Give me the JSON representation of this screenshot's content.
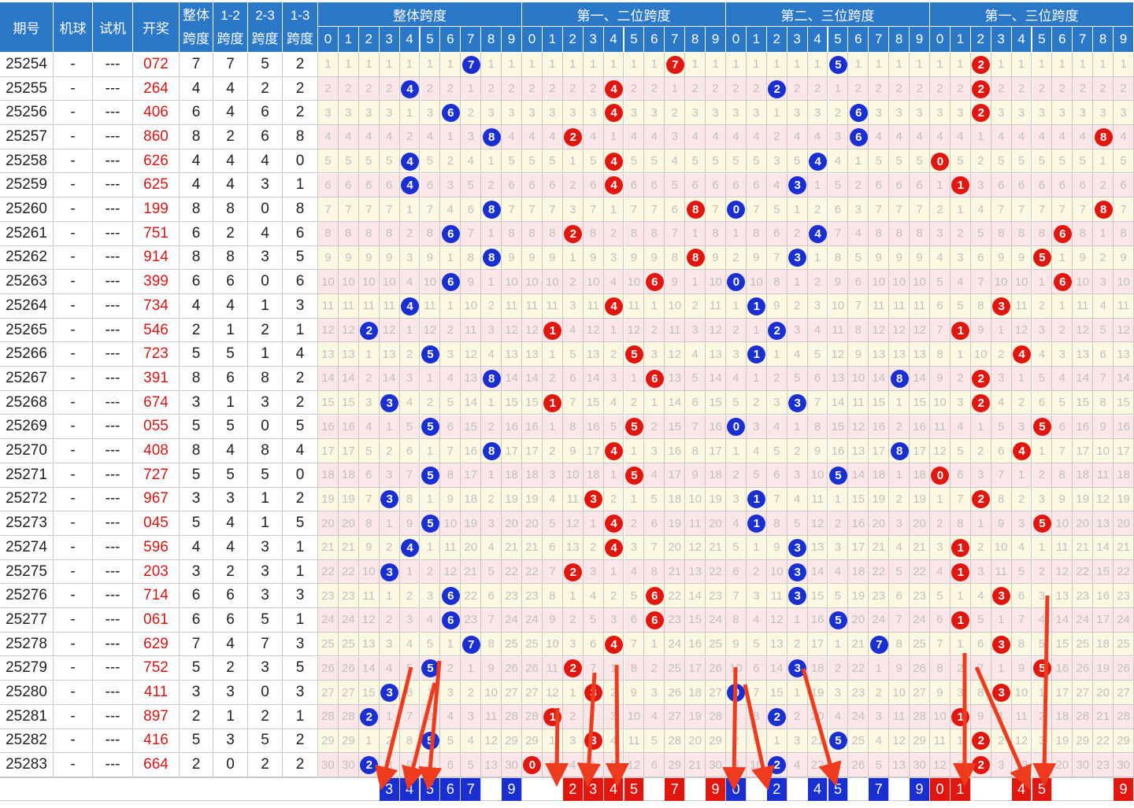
{
  "headers": {
    "issue": "期号",
    "machine": "机球",
    "trial": "试机",
    "open": "开奖",
    "span_total": "整体跨度",
    "span_12": "1-2跨度",
    "span_23": "2-3跨度",
    "span_13": "1-3跨度",
    "groups": [
      "整体跨度",
      "第一、二位跨度",
      "第二、三位跨度",
      "第一、三位跨度"
    ],
    "digits": [
      "0",
      "1",
      "2",
      "3",
      "4",
      "5",
      "6",
      "7",
      "8",
      "9"
    ]
  },
  "chart_data": {
    "type": "table",
    "columns": [
      "期号",
      "机球",
      "试机",
      "开奖",
      "整体跨度",
      "1-2跨度",
      "2-3跨度",
      "1-3跨度"
    ],
    "rows": [
      [
        "25254",
        "-",
        "---",
        "072",
        "7",
        "7",
        "5",
        "2"
      ],
      [
        "25255",
        "-",
        "---",
        "264",
        "4",
        "4",
        "2",
        "2"
      ],
      [
        "25256",
        "-",
        "---",
        "406",
        "6",
        "4",
        "6",
        "2"
      ],
      [
        "25257",
        "-",
        "---",
        "860",
        "8",
        "2",
        "6",
        "8"
      ],
      [
        "25258",
        "-",
        "---",
        "626",
        "4",
        "4",
        "4",
        "0"
      ],
      [
        "25259",
        "-",
        "---",
        "625",
        "4",
        "4",
        "3",
        "1"
      ],
      [
        "25260",
        "-",
        "---",
        "199",
        "8",
        "8",
        "0",
        "8"
      ],
      [
        "25261",
        "-",
        "---",
        "751",
        "6",
        "2",
        "4",
        "6"
      ],
      [
        "25262",
        "-",
        "---",
        "914",
        "8",
        "8",
        "3",
        "5"
      ],
      [
        "25263",
        "-",
        "---",
        "399",
        "6",
        "6",
        "0",
        "6"
      ],
      [
        "25264",
        "-",
        "---",
        "734",
        "4",
        "4",
        "1",
        "3"
      ],
      [
        "25265",
        "-",
        "---",
        "546",
        "2",
        "1",
        "2",
        "1"
      ],
      [
        "25266",
        "-",
        "---",
        "723",
        "5",
        "5",
        "1",
        "4"
      ],
      [
        "25267",
        "-",
        "---",
        "391",
        "8",
        "6",
        "8",
        "2"
      ],
      [
        "25268",
        "-",
        "---",
        "674",
        "3",
        "1",
        "3",
        "2"
      ],
      [
        "25269",
        "-",
        "---",
        "055",
        "5",
        "5",
        "0",
        "5"
      ],
      [
        "25270",
        "-",
        "---",
        "408",
        "8",
        "4",
        "8",
        "4"
      ],
      [
        "25271",
        "-",
        "---",
        "727",
        "5",
        "5",
        "5",
        "0"
      ],
      [
        "25272",
        "-",
        "---",
        "967",
        "3",
        "3",
        "1",
        "2"
      ],
      [
        "25273",
        "-",
        "---",
        "045",
        "5",
        "4",
        "1",
        "5"
      ],
      [
        "25274",
        "-",
        "---",
        "596",
        "4",
        "4",
        "3",
        "1"
      ],
      [
        "25275",
        "-",
        "---",
        "203",
        "3",
        "2",
        "3",
        "1"
      ],
      [
        "25276",
        "-",
        "---",
        "714",
        "6",
        "6",
        "3",
        "3"
      ],
      [
        "25277",
        "-",
        "---",
        "061",
        "6",
        "6",
        "5",
        "1"
      ],
      [
        "25278",
        "-",
        "---",
        "629",
        "7",
        "4",
        "7",
        "3"
      ],
      [
        "25279",
        "-",
        "---",
        "752",
        "5",
        "2",
        "3",
        "5"
      ],
      [
        "25280",
        "-",
        "---",
        "411",
        "3",
        "3",
        "0",
        "3"
      ],
      [
        "25281",
        "-",
        "---",
        "897",
        "2",
        "1",
        "2",
        "1"
      ],
      [
        "25282",
        "-",
        "---",
        "416",
        "5",
        "3",
        "5",
        "2"
      ],
      [
        "25283",
        "-",
        "---",
        "664",
        "2",
        "0",
        "2",
        "2"
      ]
    ],
    "ball_colors": [
      "blue",
      "red",
      "blue",
      "red"
    ],
    "summary": [
      [
        "3",
        "4",
        "5",
        "6",
        "7",
        "9"
      ],
      [
        "2",
        "3",
        "4",
        "5",
        "7",
        "9"
      ],
      [
        "0",
        "2",
        "4",
        "5",
        "7",
        "9"
      ],
      [
        "0",
        "1",
        "4",
        "5",
        "9"
      ]
    ]
  },
  "colors": {
    "header_bg": "#2b78c8",
    "ball_blue": "#1a2fd1",
    "ball_red": "#e0160f",
    "arrow": "#ee3b1e",
    "stripe_a": "#fdf8e2",
    "stripe_b": "#fbe7e7"
  }
}
